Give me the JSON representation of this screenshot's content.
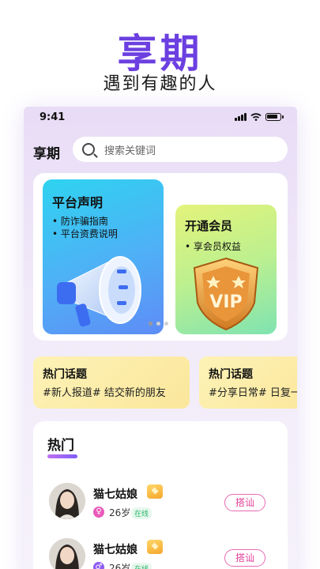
{
  "hero": {
    "title": "享期",
    "subtitle": "遇到有趣的人"
  },
  "status_bar": {
    "time": "9:41"
  },
  "header": {
    "app_name": "享期",
    "search_placeholder": "搜索关键词"
  },
  "banner": {
    "platform": {
      "title": "平台声明",
      "lines": [
        "• 防诈骗指南",
        "• 平台资费说明"
      ]
    },
    "membership": {
      "title": "开通会员",
      "line": "• 享会员权益",
      "badge_text": "VIP"
    },
    "page_indicator": {
      "current": 1,
      "total": 3
    }
  },
  "topics": [
    {
      "title": "热门话题",
      "tags": "#新人报道# 结交新的朋友"
    },
    {
      "title": "热门话题",
      "tags": "#分享日常# 日复一"
    }
  ],
  "hot": {
    "title": "热门",
    "users": [
      {
        "name": "猫七姑娘",
        "gender": "female",
        "gender_symbol": "♀",
        "age": "26岁",
        "status": "在线",
        "action": "搭讪"
      },
      {
        "name": "猫七姑娘",
        "gender": "male",
        "gender_symbol": "♂",
        "age": "26岁",
        "status": "在线",
        "action": "搭讪"
      }
    ]
  },
  "colors": {
    "accent": "#6b3fe0",
    "female": "#e95bb8",
    "male": "#8f5cf0",
    "online": "#2cb56b"
  }
}
